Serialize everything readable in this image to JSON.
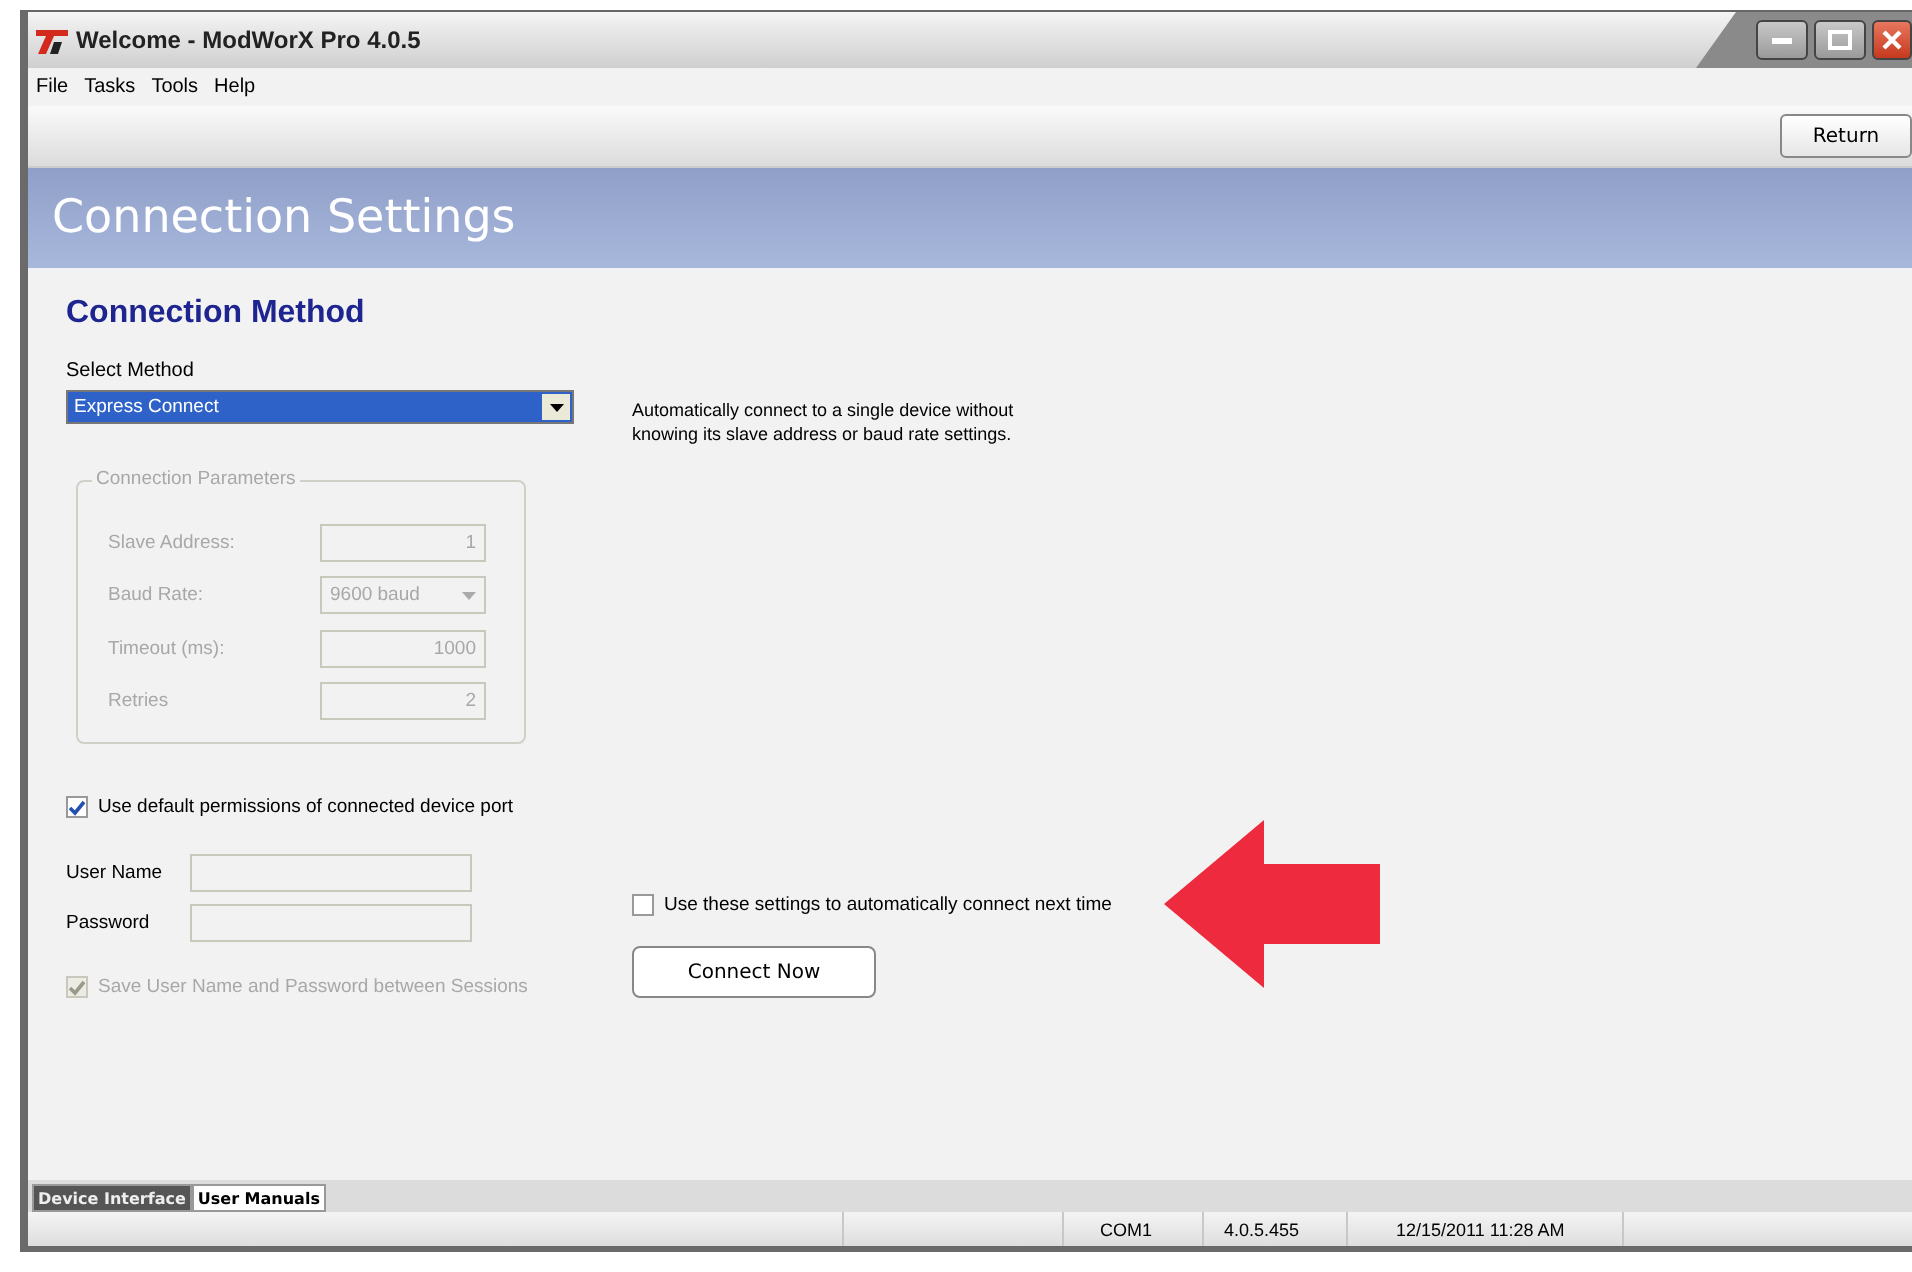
{
  "window": {
    "title": "Welcome - ModWorX Pro 4.0.5"
  },
  "menu": [
    "File",
    "Tasks",
    "Tools",
    "Help"
  ],
  "toolbar": {
    "button": "Return"
  },
  "header": {
    "title": "Connection Settings"
  },
  "section": {
    "heading": "Connection Method",
    "select_label": "Select Method",
    "select_value": "Express Connect",
    "description": "Automatically connect to a single device without knowing its slave address or baud rate settings."
  },
  "parameters": {
    "title": "Connection Parameters",
    "disabled": true,
    "fields": [
      {
        "label": "Slave Address:",
        "value": "1",
        "kind": "text"
      },
      {
        "label": "Baud Rate:",
        "value": "9600 baud",
        "kind": "select"
      },
      {
        "label": "Timeout (ms):",
        "value": "1000",
        "kind": "text"
      },
      {
        "label": "Retries",
        "value": "2",
        "kind": "text"
      }
    ]
  },
  "default_permissions": {
    "label": "Use default permissions of connected device port",
    "checked": true,
    "disabled": false
  },
  "credentials": [
    {
      "label": "User Name"
    },
    {
      "label": "Password"
    }
  ],
  "save_credentials": {
    "label": "Save User Name and Password between Sessions",
    "checked": true,
    "disabled": true
  },
  "auto_connect": {
    "label": "Use these settings to automatically connect next time",
    "checked": false,
    "disabled": false
  },
  "connect_button": "Connect Now",
  "tabs": [
    {
      "label": "Device Interface",
      "selected": true
    },
    {
      "label": "User Manuals",
      "selected": false
    }
  ],
  "status_bar": [
    "COM1",
    "4.0.5.455",
    "12/15/2011 11:28 AM"
  ]
}
